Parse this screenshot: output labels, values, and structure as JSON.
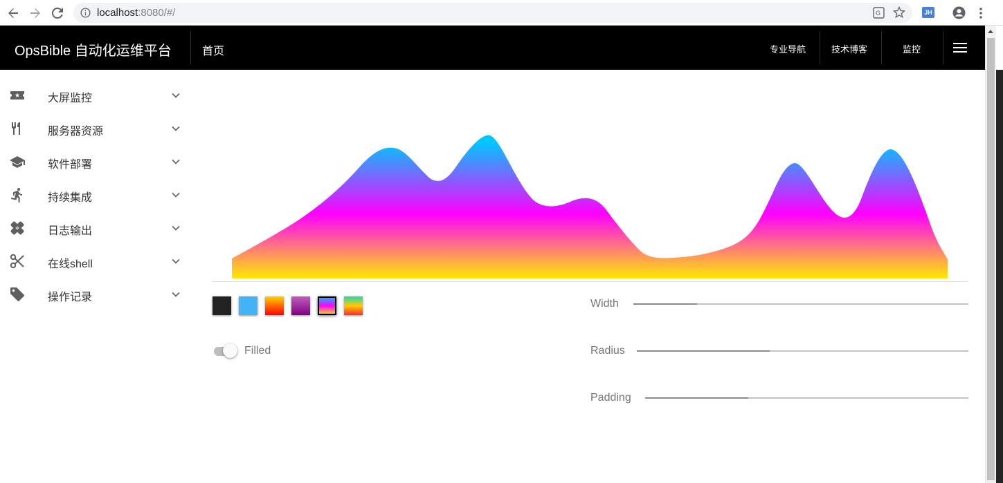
{
  "browser": {
    "url_host": "localhost",
    "url_rest": ":8080/#/",
    "extension_badge": "JH",
    "icons": [
      "back-icon",
      "forward-icon",
      "reload-icon",
      "info-icon",
      "translate-icon",
      "star-icon",
      "account-icon",
      "more-icon"
    ]
  },
  "header": {
    "brand": "OpsBible 自动化运维平台",
    "home": "首页",
    "links": [
      "专业导航",
      "技术博客",
      "监控"
    ],
    "menu_icon": "hamburger-icon"
  },
  "sidebar": {
    "items": [
      {
        "label": "大屏监控",
        "icon": "ticket-icon"
      },
      {
        "label": "服务器资源",
        "icon": "utensils-icon"
      },
      {
        "label": "软件部署",
        "icon": "graduation-cap-icon"
      },
      {
        "label": "持续集成",
        "icon": "running-icon"
      },
      {
        "label": "日志输出",
        "icon": "bandage-icon"
      },
      {
        "label": "在线shell",
        "icon": "scissors-icon"
      },
      {
        "label": "操作记录",
        "icon": "tag-icon"
      }
    ]
  },
  "sparkline": {
    "selected_gradient": 4,
    "gradient_stops": [
      "#00c6ff",
      "#f0f",
      "#ffea00"
    ],
    "swatches": [
      {
        "colors": [
          "#222222"
        ]
      },
      {
        "colors": [
          "#42b3f4"
        ]
      },
      {
        "colors": [
          "#ffd200",
          "#f00"
        ]
      },
      {
        "colors": [
          "#c15dc1",
          "#800080"
        ]
      },
      {
        "colors": [
          "#00c6ff",
          "#f0f",
          "#ffea00"
        ]
      },
      {
        "colors": [
          "#1fd9b3",
          "#ffcc00",
          "#ff2a2a"
        ]
      }
    ],
    "filled_label": "Filled",
    "filled": false,
    "sliders": [
      {
        "label": "Width",
        "value": 0.19
      },
      {
        "label": "Radius",
        "value": 0.4
      },
      {
        "label": "Padding",
        "value": 0.32
      }
    ]
  }
}
